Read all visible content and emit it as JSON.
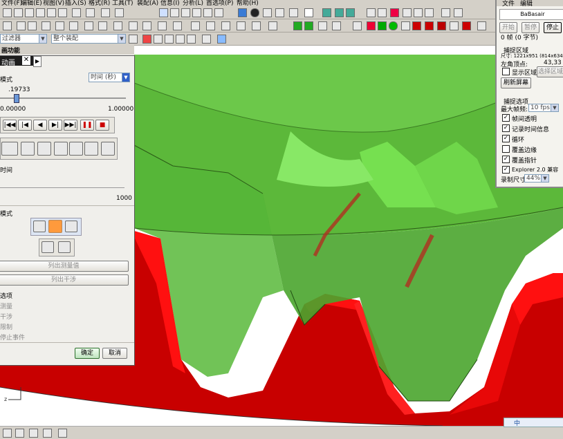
{
  "menubar": {
    "items": [
      "文件(F)",
      "编辑(E)",
      "视图(V)",
      "插入(S)",
      "格式(R)",
      "工具(T)",
      "装配(A)",
      "信息(I)",
      "分析(L)",
      "首选项(P)",
      "帮助(H)"
    ]
  },
  "toolbar": {
    "selection_filter_label": "过滤器",
    "assembly_combo": "整个装配"
  },
  "function_row": {
    "label": "画功能"
  },
  "animation_dialog": {
    "tab_label": "动画",
    "close_label": "✕",
    "scroll_label": "▶",
    "mode_label": "模式",
    "time_unit": "时间 (秒)",
    "time_value": ".19733",
    "slider_min": "0.00000",
    "slider_max": "1.00000",
    "transport": {
      "first": "|◀◀",
      "prev": "|◀",
      "play_back": "◀",
      "play": "▶|",
      "last": "▶▶|",
      "pause": "❚❚",
      "stop": "■"
    },
    "time_label": "时间",
    "frame_max": "1000",
    "playback_mode_label": "模式",
    "btn_list_1": "列出测量值",
    "btn_list_2": "列出干涉",
    "options_label": "选项",
    "option_items": [
      "测量",
      "干涉",
      "限制",
      "停止事件"
    ],
    "ok_label": "确定",
    "cancel_label": "取消"
  },
  "capture_tool": {
    "menu_file": "文件",
    "menu_edit": "编辑",
    "title": "BaBasair",
    "btn_start": "开始",
    "btn_pause": "暂停",
    "btn_stop": "停止",
    "frames": "0 帧 (0 字节)",
    "region_group": "捕捉区域",
    "size_label": "尺寸: 1221x951 (814x634)",
    "topleft_label": "左角顶点:",
    "topleft_value": "43,33",
    "show_region": "显示区域",
    "select_region": "选择区域",
    "refresh_screen": "刷新屏幕",
    "options_group": "捕捉选项",
    "max_fps_label": "最大帧频:",
    "max_fps_value": "10 fps",
    "opt_translucent": "帧间透明",
    "opt_record_time": "记录时间信息",
    "opt_loop": "循环",
    "opt_cover_border": "覆盖边缘",
    "opt_cover_cursor": "覆盖指针",
    "opt_explorer": "Explorer 2.0 兼容",
    "record_size_label": "录制尺寸",
    "record_size_value": "44%"
  },
  "status_bar": {
    "ime_text": "中"
  },
  "colors": {
    "gear_red": "#c80000",
    "gear_bright_red": "#ff1010",
    "transparent_green": "#5cb83a",
    "toolbar_bg": "#d4d0c8"
  }
}
